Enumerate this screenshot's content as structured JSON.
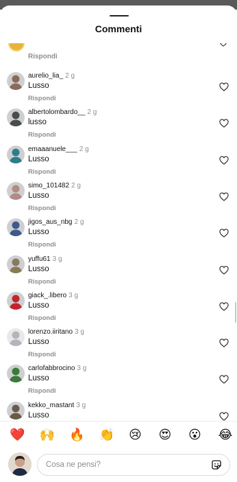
{
  "sheet": {
    "title": "Commenti"
  },
  "partial": {
    "reply": "Rispondi"
  },
  "comments": [
    {
      "username": "aurelio_lia_",
      "time": "2 g",
      "text": "Lusso",
      "reply": "Rispondi",
      "avatar_color": "#8a6a5a"
    },
    {
      "username": "albertolombardo__",
      "time": "2 g",
      "text": "lusso",
      "reply": "Rispondi",
      "avatar_color": "#4a4e4a"
    },
    {
      "username": "emaaanuele___",
      "time": "2 g",
      "text": "Lusso",
      "reply": "Rispondi",
      "avatar_color": "#2e7d8a"
    },
    {
      "username": "simo_101482",
      "time": "2 g",
      "text": "Lusso",
      "reply": "Rispondi",
      "avatar_color": "#b08c86"
    },
    {
      "username": "jigos_aus_nbg",
      "time": "2 g",
      "text": "Lusso",
      "reply": "Rispondi",
      "avatar_color": "#3d5a8a"
    },
    {
      "username": "yuffu61",
      "time": "3 g",
      "text": "Lusso",
      "reply": "Rispondi",
      "avatar_color": "#8a7a5a"
    },
    {
      "username": "giack_.libero",
      "time": "3 g",
      "text": "Lusso",
      "reply": "Rispondi",
      "avatar_color": "#c0262d"
    },
    {
      "username": "lorenzo.iiritano",
      "time": "3 g",
      "text": "Lusso",
      "reply": "Rispondi",
      "avatar_color": "#d4d4d8"
    },
    {
      "username": "carlofabbrocino",
      "time": "3 g",
      "text": "Lusso",
      "reply": "Rispondi",
      "avatar_color": "#3a7a3a"
    },
    {
      "username": "kekko_mastant",
      "time": "3 g",
      "text": "Lusso",
      "reply": "",
      "avatar_color": "#6a5a4a"
    }
  ],
  "emojis": [
    "❤️",
    "🙌",
    "🔥",
    "👏",
    "😢",
    "😍",
    "😮",
    "😂"
  ],
  "input": {
    "placeholder": "Cosa ne pensi?"
  }
}
